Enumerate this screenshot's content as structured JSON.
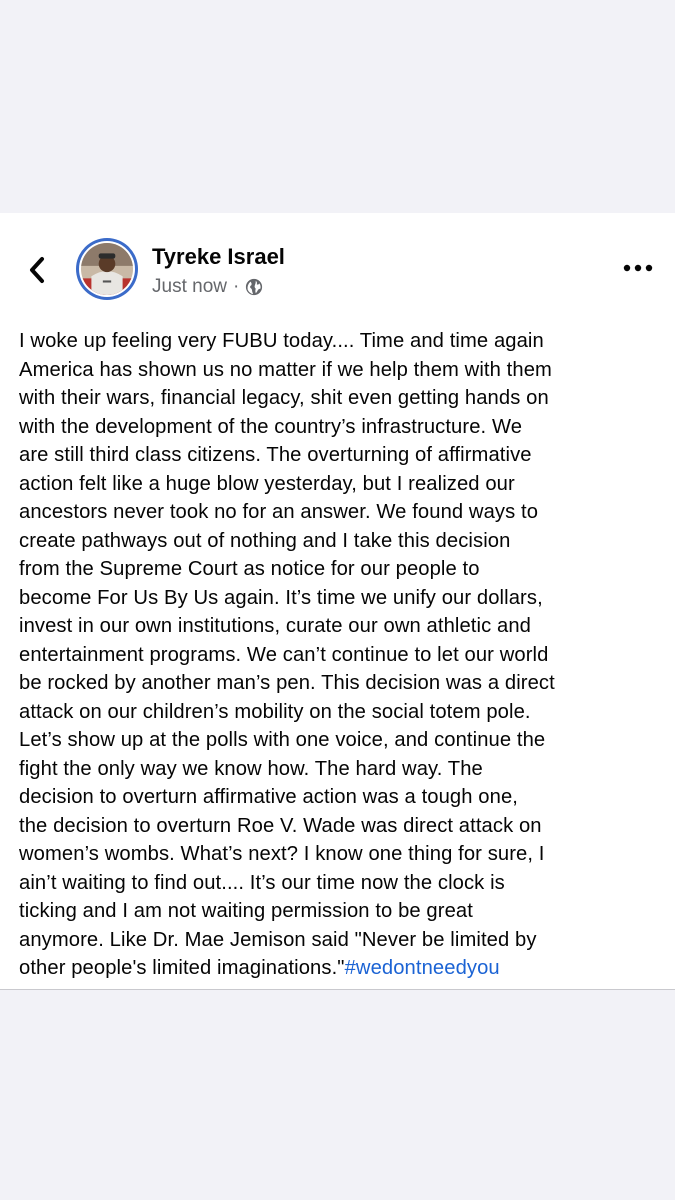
{
  "post": {
    "author": "Tyreke Israel",
    "timestamp": "Just now",
    "separator": "·",
    "privacy_icon": "globe-icon",
    "body_lines": [
      "I woke up feeling very FUBU today.... Time and time again",
      "America has shown us no matter if we help them with them",
      "with their wars, financial legacy, shit even getting hands on",
      "with the development of the country’s infrastructure. We",
      "are still third class citizens. The overturning of affirmative",
      "action felt like a huge blow yesterday, but I realized our",
      "ancestors never took no for an answer. We found ways to",
      "create pathways out of nothing and I take this decision",
      "from the Supreme Court as notice for our people to",
      "become For Us By Us again. It’s time we unify our dollars,",
      "invest in our own institutions, curate our own athletic and",
      "entertainment programs. We can’t continue to let our world",
      "be rocked by another man’s pen. This decision was a direct",
      "attack on our children’s mobility on the social totem pole.",
      "Let’s show up at the polls with one voice, and continue the",
      "fight the only way we know how. The hard way. The",
      "decision to overturn affirmative action was a tough one,",
      "the decision to overturn Roe V. Wade was direct attack on",
      "women’s wombs. What’s next? I know one thing for sure, I",
      "ain’t waiting to find out.... It’s our time now the clock is",
      "ticking and I am not waiting permission to be great",
      "anymore. Like Dr. Mae Jemison said \"Never be limited by"
    ],
    "last_line_text": "other people's limited imaginations.\"",
    "hashtag": "#wedontneedyou"
  },
  "nav": {
    "back_icon": "chevron-left-icon",
    "more_icon": "more-dots-icon"
  },
  "colors": {
    "background": "#f2f2f7",
    "card": "#ffffff",
    "text": "#050505",
    "secondary_text": "#65676b",
    "hashtag": "#1b63d4",
    "avatar_ring": "#3b6bc9"
  }
}
